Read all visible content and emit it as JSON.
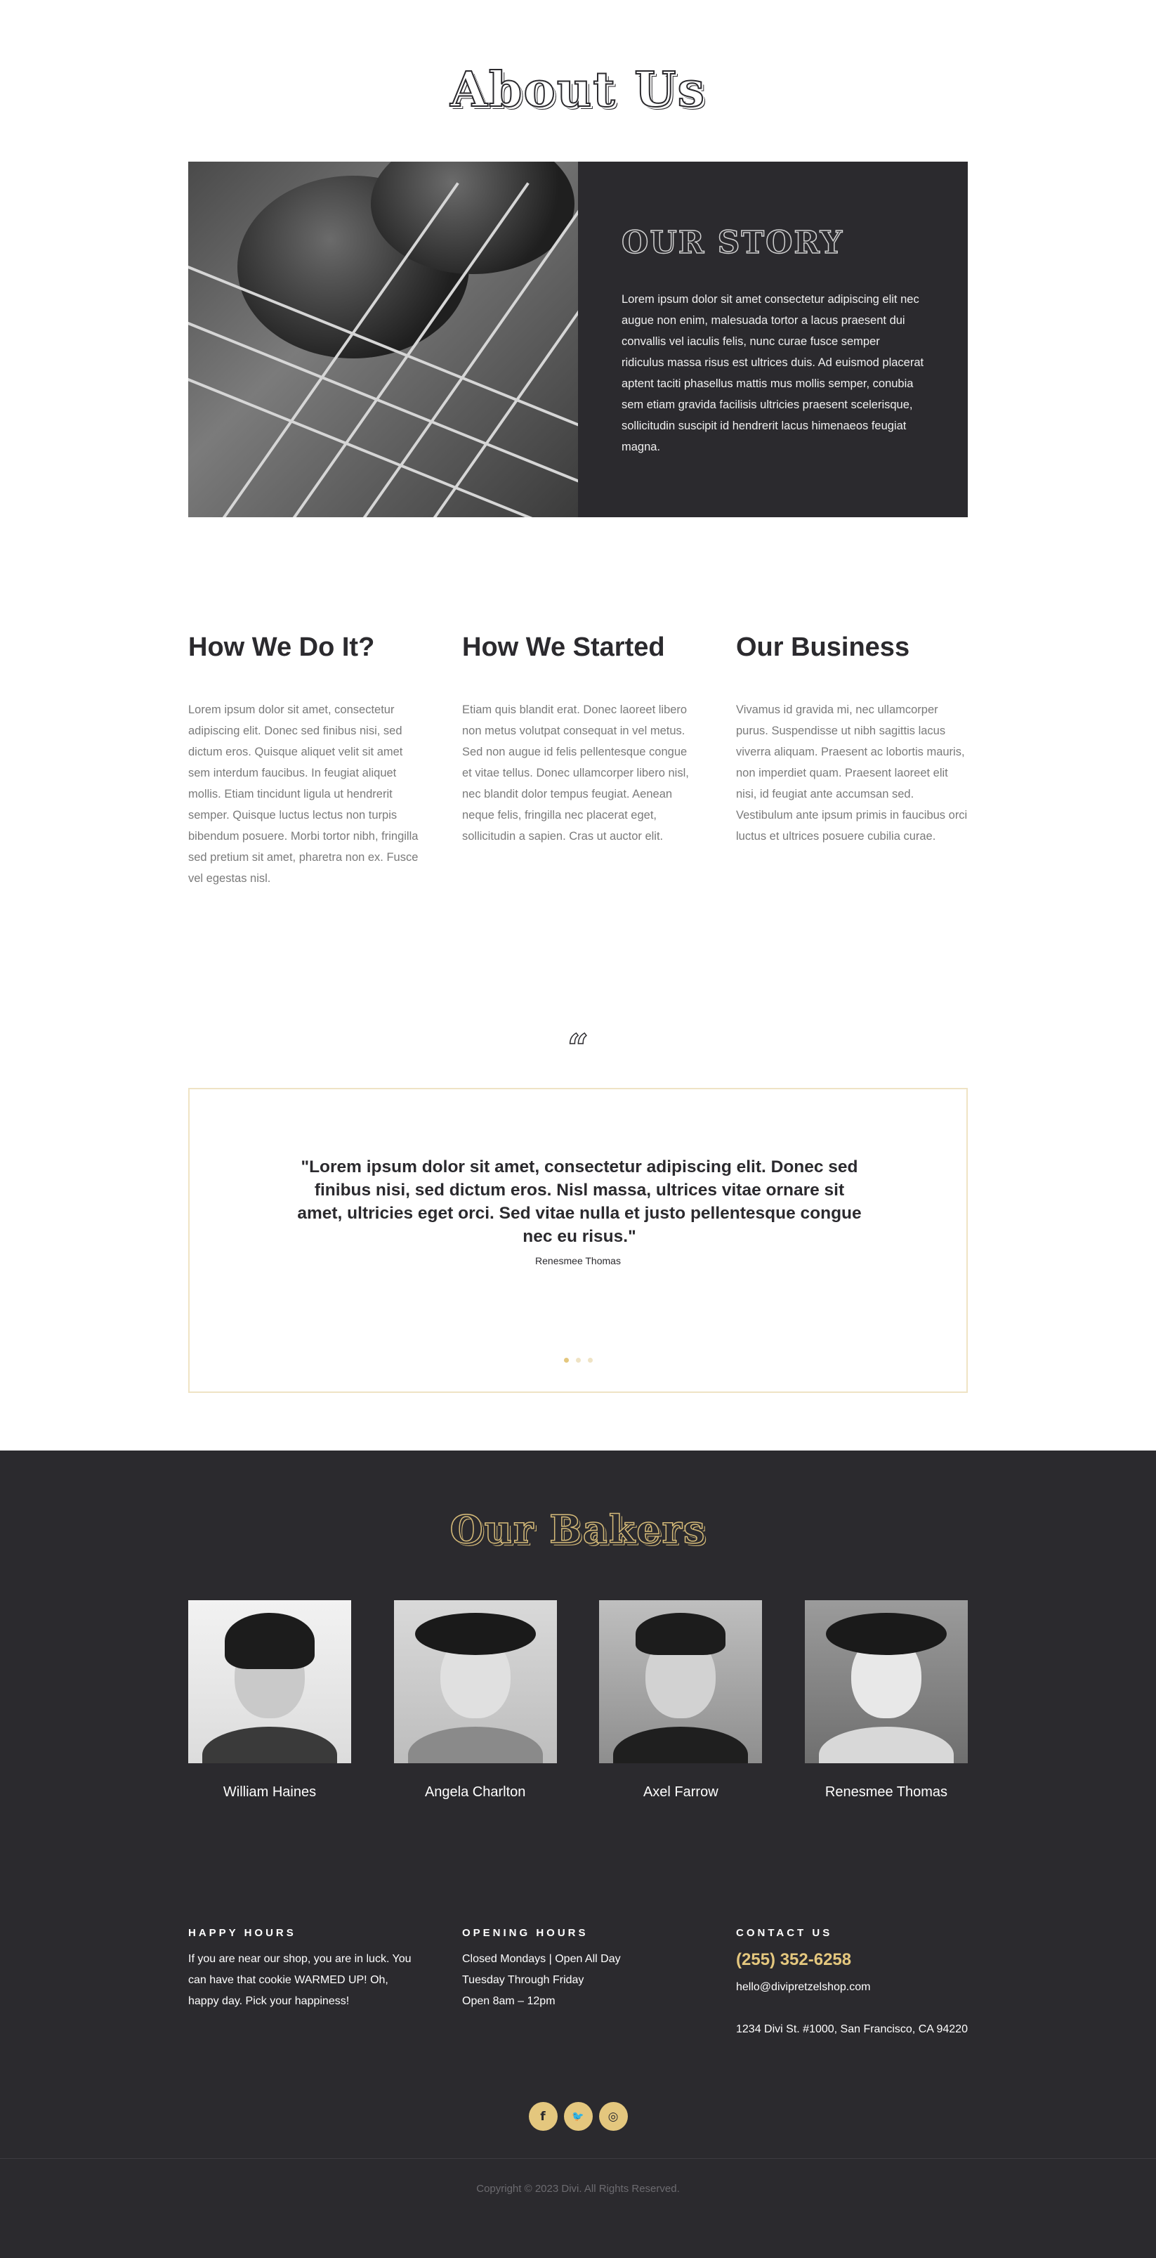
{
  "about": {
    "title": "About Us"
  },
  "story": {
    "heading": "OUR STORY",
    "body": "Lorem ipsum dolor sit amet consectetur adipiscing elit nec augue non enim, malesuada tortor a lacus praesent dui convallis vel iaculis felis, nunc curae fusce semper ridiculus massa risus est ultrices duis. Ad euismod placerat aptent taciti phasellus mattis mus mollis semper, conubia sem etiam gravida facilisis ultricies praesent scelerisque, sollicitudin suscipit id hendrerit lacus himenaeos feugiat magna.",
    "image": "pretzels-on-rack-photo"
  },
  "columns": [
    {
      "heading": "How We Do It?",
      "body": "Lorem ipsum dolor sit amet, consectetur adipiscing elit. Donec sed finibus nisi, sed dictum eros. Quisque aliquet velit sit amet sem interdum faucibus. In feugiat aliquet mollis. Etiam tincidunt ligula ut hendrerit semper. Quisque luctus lectus non turpis bibendum posuere. Morbi tortor nibh, fringilla sed pretium sit amet, pharetra non ex. Fusce vel egestas nisl."
    },
    {
      "heading": "How We Started",
      "body": "Etiam quis blandit erat. Donec laoreet libero non metus volutpat consequat in vel metus. Sed non augue id felis pellentesque congue et vitae tellus. Donec ullamcorper libero nisl, nec blandit dolor tempus feugiat. Aenean neque felis, fringilla nec placerat eget, sollicitudin a sapien. Cras ut auctor elit."
    },
    {
      "heading": "Our Business",
      "body": "Vivamus id gravida mi, nec ullamcorper purus. Suspendisse ut nibh sagittis lacus viverra aliquam. Praesent ac lobortis mauris, non imperdiet quam. Praesent laoreet elit nisi, id feugiat ante accumsan sed. Vestibulum ante ipsum primis in faucibus orci luctus et ultrices posuere cubilia curae."
    }
  ],
  "testimonial": {
    "quote_mark": "“",
    "quote": "\"Lorem ipsum dolor sit amet, consectetur adipiscing elit. Donec sed finibus nisi, sed dictum eros. Nisl massa, ultrices vitae ornare sit amet, ultricies eget orci. Sed vitae nulla et justo pellentesque congue nec eu risus.\"",
    "author": "Renesmee Thomas",
    "slides": 3,
    "active_slide": 1
  },
  "bakers": {
    "title": "Our Bakers",
    "members": [
      {
        "name": "William Haines",
        "photo": "william-haines-portrait"
      },
      {
        "name": "Angela Charlton",
        "photo": "angela-charlton-portrait"
      },
      {
        "name": "Axel Farrow",
        "photo": "axel-farrow-portrait"
      },
      {
        "name": "Renesmee Thomas",
        "photo": "renesmee-thomas-portrait"
      }
    ]
  },
  "footer": {
    "happy_hours": {
      "heading": "HAPPY HOURS",
      "text": "If you are near our shop, you are in luck. You can have that cookie WARMED UP! Oh, happy day. Pick your happiness!"
    },
    "opening_hours": {
      "heading": "OPENING HOURS",
      "line1": "Closed Mondays | Open All Day",
      "line2": "Tuesday Through Friday",
      "line3": "Open 8am – 12pm"
    },
    "contact": {
      "heading": "CONTACT US",
      "phone": "(255) 352-6258",
      "email": "hello@divipretzelshop.com",
      "address": "1234 Divi St. #1000, San Francisco, CA 94220"
    },
    "socials": [
      {
        "icon": "facebook-icon",
        "glyph": "f"
      },
      {
        "icon": "twitter-icon",
        "glyph": "🐦"
      },
      {
        "icon": "instagram-icon",
        "glyph": "◎"
      }
    ],
    "copyright": "Copyright © 2023 Divi. All Rights Reserved."
  },
  "colors": {
    "dark": "#2b2a2e",
    "gold": "#e4c77e",
    "border": "#efe3c4"
  }
}
